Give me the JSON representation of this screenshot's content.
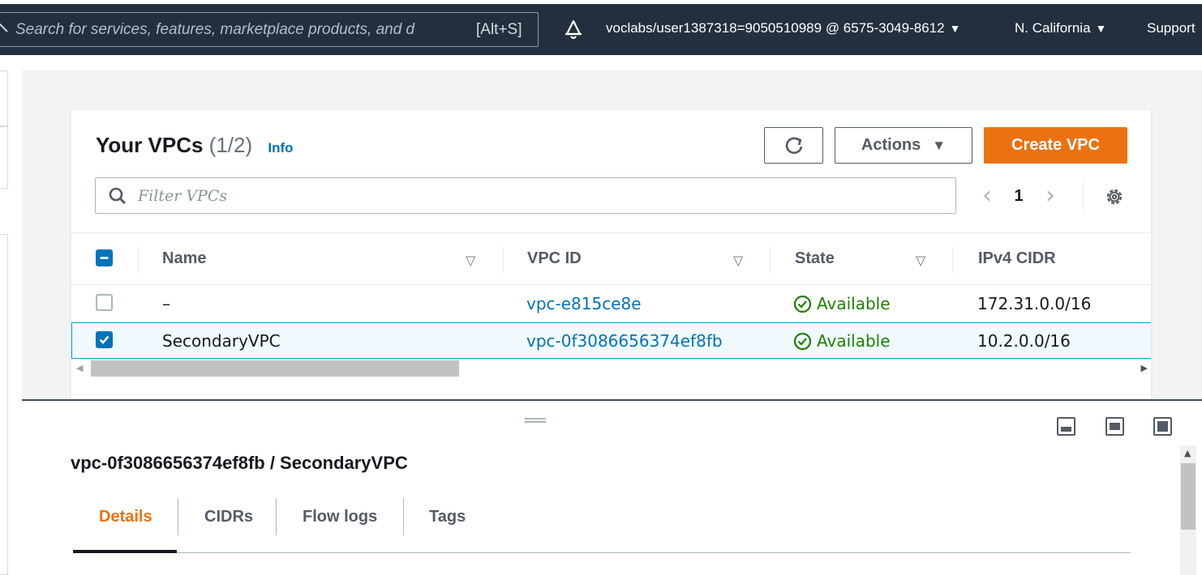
{
  "topnav": {
    "search_placeholder": "Search for services, features, marketplace products, and d",
    "search_shortcut": "[Alt+S]",
    "account": "voclabs/user1387318=9050510989 @ 6575-3049-8612",
    "region": "N. California",
    "support": "Support",
    "caret": "▼"
  },
  "vpcs": {
    "title": "Your VPCs",
    "count": "(1/2)",
    "info": "Info",
    "actions_label": "Actions",
    "create_label": "Create VPC",
    "filter_placeholder": "Filter VPCs",
    "page": "1",
    "columns": [
      "Name",
      "VPC ID",
      "State",
      "IPv4 CIDR"
    ],
    "rows": [
      {
        "name": "–",
        "vpc_id": "vpc-e815ce8e",
        "state": "Available",
        "cidr": "172.31.0.0/16",
        "selected": false
      },
      {
        "name": "SecondaryVPC",
        "vpc_id": "vpc-0f3086656374ef8fb",
        "state": "Available",
        "cidr": "10.2.0.0/16",
        "selected": true
      }
    ]
  },
  "details": {
    "title": "vpc-0f3086656374ef8fb / SecondaryVPC",
    "tabs": [
      "Details",
      "CIDRs",
      "Flow logs",
      "Tags"
    ],
    "active_tab": "Details"
  },
  "colors": {
    "nav_bg": "#232f3e",
    "accent_orange": "#ec7211",
    "link_blue": "#0073bb",
    "success_green": "#1d8102"
  }
}
